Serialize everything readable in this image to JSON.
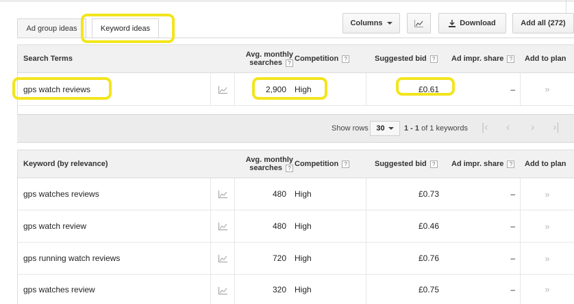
{
  "tabs": [
    {
      "label": "Ad group ideas",
      "active": false
    },
    {
      "label": "Keyword ideas",
      "active": true
    }
  ],
  "toolbar": {
    "columns_label": "Columns",
    "download_label": "Download",
    "add_all_label": "Add all (272)"
  },
  "search_table": {
    "columns": {
      "term": "Search Terms",
      "avg_line1": "Avg. monthly",
      "avg_line2": "searches",
      "competition": "Competition",
      "bid": "Suggested bid",
      "impr": "Ad impr. share",
      "add": "Add to plan"
    },
    "rows": [
      {
        "keyword": "gps watch reviews",
        "searches": "2,900",
        "competition": "High",
        "bid": "£0.61",
        "impr": "–",
        "add": "»"
      }
    ]
  },
  "pager": {
    "show_rows_label": "Show rows",
    "rows_value": "30",
    "range": "1 - 1",
    "of_label": "of 1 keywords"
  },
  "ideas_table": {
    "columns": {
      "term": "Keyword (by relevance)",
      "avg_line1": "Avg. monthly",
      "avg_line2": "searches",
      "competition": "Competition",
      "bid": "Suggested bid",
      "impr": "Ad impr. share",
      "add": "Add to plan"
    },
    "rows": [
      {
        "keyword": "gps watches reviews",
        "searches": "480",
        "competition": "High",
        "bid": "£0.73",
        "impr": "–",
        "add": "»"
      },
      {
        "keyword": "gps watch review",
        "searches": "480",
        "competition": "High",
        "bid": "£0.46",
        "impr": "–",
        "add": "»"
      },
      {
        "keyword": "gps running watch reviews",
        "searches": "720",
        "competition": "High",
        "bid": "£0.76",
        "impr": "–",
        "add": "»"
      },
      {
        "keyword": "gps watches review",
        "searches": "320",
        "competition": "High",
        "bid": "£0.75",
        "impr": "–",
        "add": "»"
      }
    ]
  },
  "highlight_color": "#f3e51d"
}
